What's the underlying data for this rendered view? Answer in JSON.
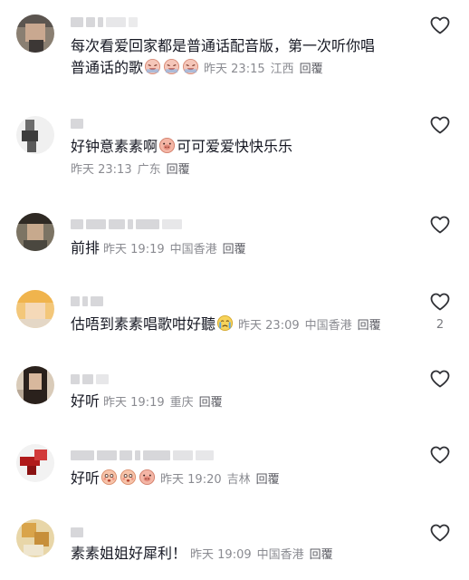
{
  "comments": [
    {
      "text": "每次看爱回家都是普通话配音版，第一次听你唱",
      "text2": "普通话的歌",
      "emojis": [
        "laugh-cry-emoji",
        "laugh-cry-emoji",
        "laugh-cry-emoji"
      ],
      "time": "昨天 23:15",
      "location": "江西",
      "reply": "回覆",
      "likes": ""
    },
    {
      "text": "好钟意素素啊",
      "text_after": "可可爱爱快快乐乐",
      "emojis": [
        "pig-face-emoji"
      ],
      "time": "昨天 23:13",
      "location": "广东",
      "reply": "回覆",
      "likes": ""
    },
    {
      "text": "前排",
      "time": "昨天 19:19",
      "location": "中国香港",
      "reply": "回覆",
      "likes": ""
    },
    {
      "text": "估唔到素素唱歌咁好聽",
      "emojis": [
        "crying-face-emoji"
      ],
      "time": "昨天 23:09",
      "location": "中国香港",
      "reply": "回覆",
      "likes": "2"
    },
    {
      "text": "好听",
      "time": "昨天 19:19",
      "location": "重庆",
      "reply": "回覆",
      "likes": ""
    },
    {
      "text": "好听",
      "emojis": [
        "flushed-face-emoji",
        "flushed-face-emoji",
        "pig-face-emoji"
      ],
      "time": "昨天 19:20",
      "location": "吉林",
      "reply": "回覆",
      "likes": ""
    },
    {
      "text": "素素姐姐好犀利！",
      "time": "昨天 19:09",
      "location": "中国香港",
      "reply": "回覆",
      "likes": ""
    }
  ],
  "icons": {
    "like": "heart-outline-icon"
  },
  "colors": {
    "text": "#161823",
    "meta": "#8a8b91",
    "heart": "#2f3035",
    "redacted": "#d7d7da"
  }
}
